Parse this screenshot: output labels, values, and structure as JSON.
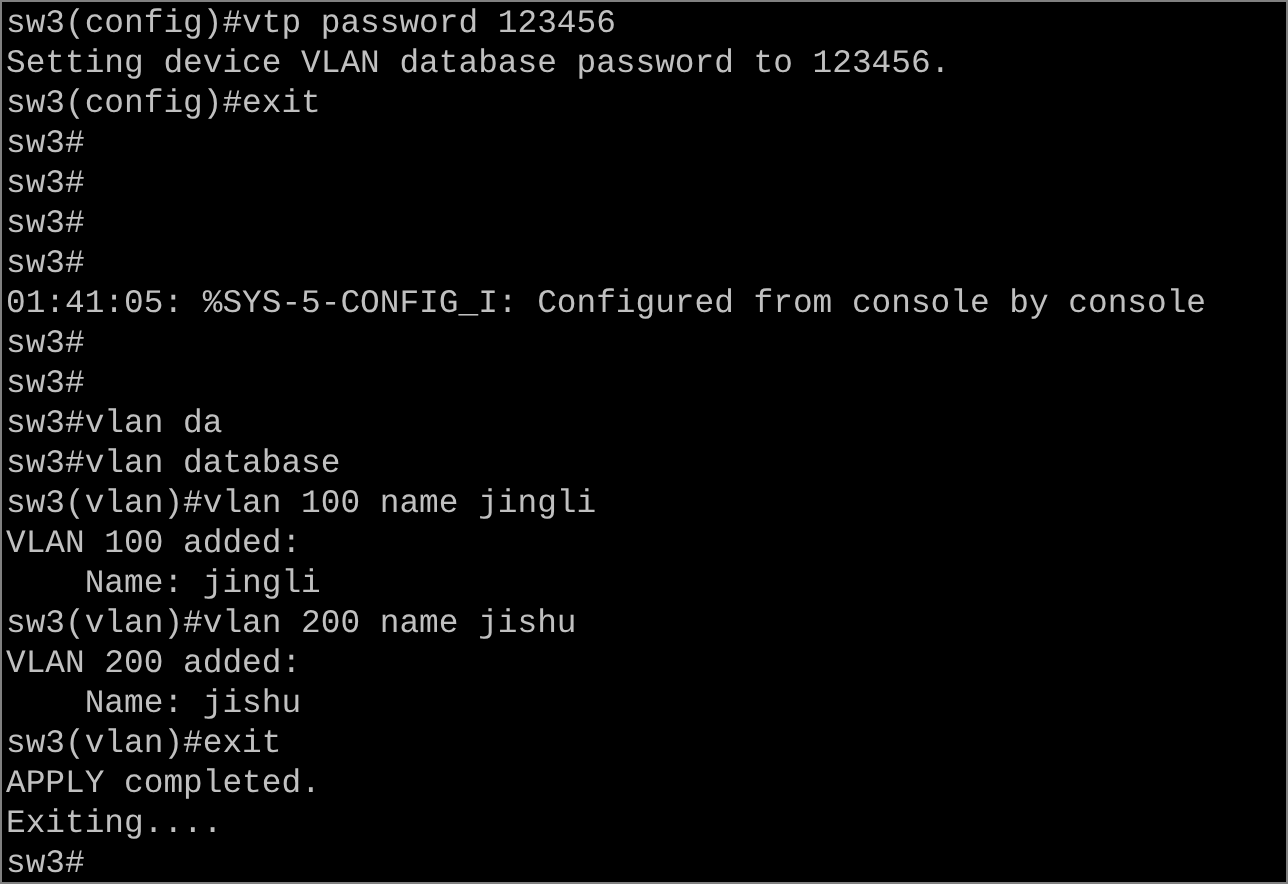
{
  "terminal": {
    "lines": [
      "sw3(config)#vtp password 123456",
      "Setting device VLAN database password to 123456.",
      "sw3(config)#exit",
      "sw3#",
      "sw3#",
      "sw3#",
      "sw3#",
      "01:41:05: %SYS-5-CONFIG_I: Configured from console by console",
      "sw3#",
      "sw3#",
      "sw3#vlan da",
      "sw3#vlan database",
      "sw3(vlan)#vlan 100 name jingli",
      "VLAN 100 added:",
      "    Name: jingli",
      "sw3(vlan)#vlan 200 name jishu",
      "VLAN 200 added:",
      "    Name: jishu",
      "sw3(vlan)#exit",
      "APPLY completed.",
      "Exiting....",
      "sw3#"
    ]
  }
}
